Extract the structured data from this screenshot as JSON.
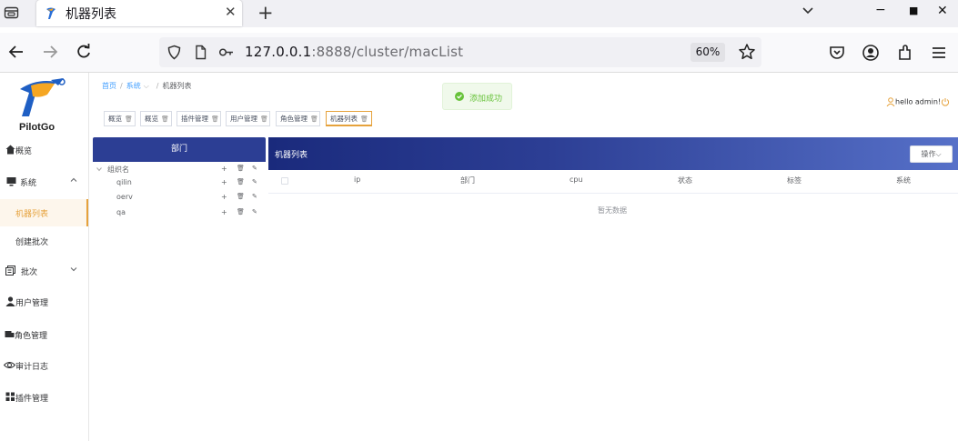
{
  "browser": {
    "tab_title": "机器列表",
    "url_host": "127.0.0.1",
    "url_rest": ":8888/cluster/macList",
    "zoom": "60%"
  },
  "sidebar": {
    "logo_text": "PilotGo",
    "items": [
      {
        "label": "概览",
        "icon": "home-icon"
      },
      {
        "label": "系统",
        "icon": "monitor-icon"
      },
      {
        "label": "机器列表",
        "icon": ""
      },
      {
        "label": "创建批次",
        "icon": ""
      },
      {
        "label": "批次",
        "icon": "batch-icon"
      },
      {
        "label": "用户管理",
        "icon": "user-icon"
      },
      {
        "label": "角色管理",
        "icon": "role-icon"
      },
      {
        "label": "审计日志",
        "icon": "eye-icon"
      },
      {
        "label": "插件管理",
        "icon": "grid-icon"
      }
    ]
  },
  "breadcrumb": {
    "home": "首页",
    "system": "系统",
    "current": "机器列表"
  },
  "toast": {
    "text": "添加成功"
  },
  "user": {
    "greeting": "hello admin!"
  },
  "tags": [
    {
      "label": "概览"
    },
    {
      "label": "概览"
    },
    {
      "label": "插件管理"
    },
    {
      "label": "用户管理"
    },
    {
      "label": "角色管理"
    },
    {
      "label": "机器列表"
    }
  ],
  "department": {
    "title": "部门",
    "root": "组织名",
    "children": [
      "qilin",
      "oerv",
      "qa"
    ]
  },
  "machine_list": {
    "title": "机器列表",
    "operation_button": "操作",
    "columns": [
      "ip",
      "部门",
      "cpu",
      "状态",
      "标签",
      "系统"
    ],
    "empty_text": "暂无数据"
  },
  "colors": {
    "accent": "#e6a23c",
    "header_blue": "#2c3e94",
    "success": "#67c23a",
    "link": "#409eff"
  }
}
